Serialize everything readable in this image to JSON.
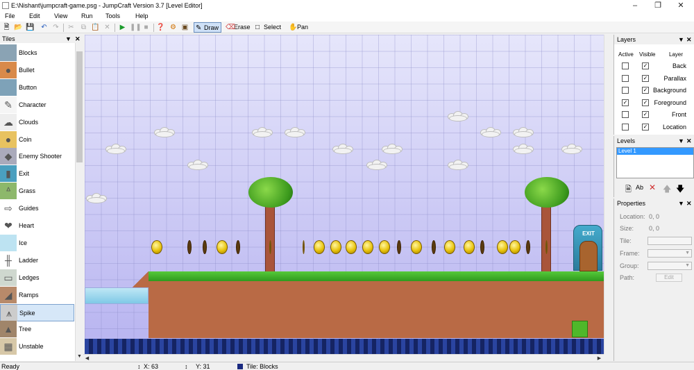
{
  "window": {
    "title": "E:\\Nishant\\jumpcraft-game.psg - JumpCraft Version 3.7 [Level Editor]"
  },
  "menu": [
    "File",
    "Edit",
    "View",
    "Run",
    "Tools",
    "Help"
  ],
  "toolbar": {
    "draw": "Draw",
    "erase": "Erase",
    "select": "Select",
    "pan": "Pan"
  },
  "tiles": {
    "title": "Tiles",
    "items": [
      "Blocks",
      "Bullet",
      "Button",
      "Character",
      "Clouds",
      "Coin",
      "Enemy Shooter",
      "Exit",
      "Grass",
      "Guides",
      "Heart",
      "Ice",
      "Ladder",
      "Ledges",
      "Ramps",
      "Spike",
      "Tree",
      "Unstable"
    ],
    "selected": "Spike"
  },
  "layers": {
    "title": "Layers",
    "headers": [
      "Active",
      "Visible",
      "Layer"
    ],
    "rows": [
      {
        "name": "Back",
        "active": false,
        "visible": true
      },
      {
        "name": "Parallax",
        "active": false,
        "visible": true
      },
      {
        "name": "Background",
        "active": false,
        "visible": true
      },
      {
        "name": "Foreground",
        "active": true,
        "visible": true
      },
      {
        "name": "Front",
        "active": false,
        "visible": true
      },
      {
        "name": "Location",
        "active": false,
        "visible": true
      }
    ]
  },
  "levels": {
    "title": "Levels",
    "items": [
      "Level 1"
    ]
  },
  "properties": {
    "title": "Properties",
    "location_label": "Location:",
    "location_value": "0, 0",
    "size_label": "Size:",
    "size_value": "0, 0",
    "tile_label": "Tile:",
    "frame_label": "Frame:",
    "group_label": "Group:",
    "path_label": "Path:",
    "edit_button": "Edit"
  },
  "exit_sign": "EXIT",
  "status": {
    "ready": "Ready",
    "x": "X: 63",
    "y": "Y: 31",
    "tile": "Tile: Blocks"
  }
}
